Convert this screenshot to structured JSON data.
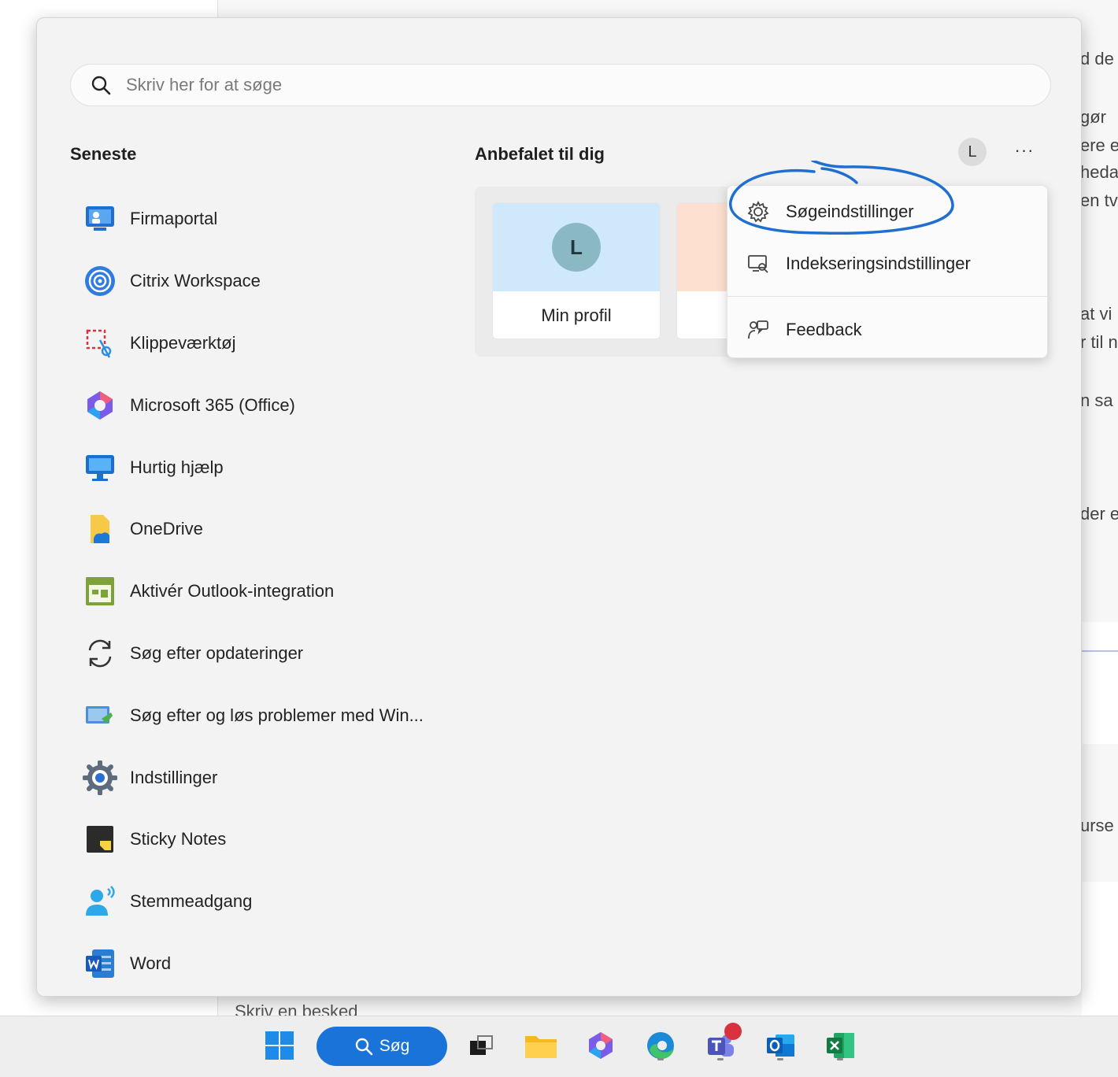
{
  "background": {
    "right_fragments": [
      "d de",
      "gør",
      "ere e",
      "heda",
      "en tv",
      "at vi",
      "r til n",
      "n sa",
      "der e",
      "urse"
    ],
    "bottom_text": "Skriv en besked"
  },
  "search": {
    "placeholder": "Skriv her for at søge",
    "icon": "search-icon"
  },
  "recent": {
    "title": "Seneste",
    "items": [
      {
        "label": "Firmaportal",
        "icon": "firmaportal-icon"
      },
      {
        "label": "Citrix Workspace",
        "icon": "citrix-icon"
      },
      {
        "label": "Klippeværktøj",
        "icon": "snipping-tool-icon"
      },
      {
        "label": "Microsoft 365 (Office)",
        "icon": "m365-icon"
      },
      {
        "label": "Hurtig hjælp",
        "icon": "quick-assist-icon"
      },
      {
        "label": "OneDrive",
        "icon": "onedrive-icon"
      },
      {
        "label": "Aktivér Outlook-integration",
        "icon": "outlook-integration-icon"
      },
      {
        "label": "Søg efter opdateringer",
        "icon": "update-icon"
      },
      {
        "label": "Søg efter og løs problemer med Win...",
        "icon": "troubleshoot-icon"
      },
      {
        "label": "Indstillinger",
        "icon": "settings-icon"
      },
      {
        "label": "Sticky Notes",
        "icon": "sticky-notes-icon"
      },
      {
        "label": "Stemmeadgang",
        "icon": "voice-access-icon"
      },
      {
        "label": "Word",
        "icon": "word-icon"
      }
    ]
  },
  "recommended": {
    "title": "Anbefalet til dig",
    "avatar_initial": "L",
    "more_label": "···",
    "profile_card": {
      "initial": "L",
      "label": "Min profil"
    }
  },
  "context_menu": {
    "items": [
      {
        "label": "Søgeindstillinger",
        "icon": "gear-icon"
      },
      {
        "label": "Indekseringsindstillinger",
        "icon": "indexing-icon"
      },
      {
        "label": "Feedback",
        "icon": "feedback-icon"
      }
    ]
  },
  "taskbar": {
    "search_label": "Søg",
    "items": [
      "windows-start-icon",
      "task-view-icon",
      "file-explorer-icon",
      "copilot-icon",
      "edge-icon",
      "teams-icon",
      "outlook-icon",
      "excel-icon"
    ]
  },
  "colors": {
    "accent": "#1a73d9",
    "highlight_ring": "#1f6fd1",
    "panel_bg": "#f3f3f3",
    "badge": "#d9313d"
  }
}
